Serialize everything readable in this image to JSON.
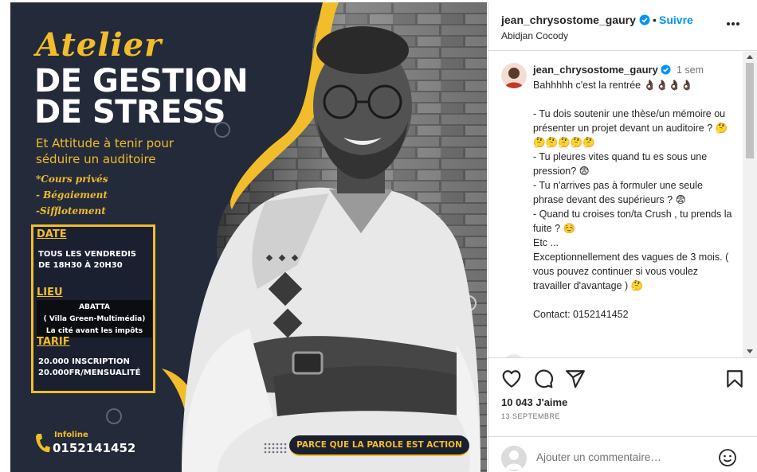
{
  "poster": {
    "atelier": "Atelier",
    "title_line_1": "DE GESTION",
    "title_line_2": "DE STRESS",
    "subtitle": "Et Attitude à tenir pour séduire un auditoire",
    "bullets": [
      "*Cours privés",
      "- Bégaiement",
      "-Sifflotement"
    ],
    "date_label": "DATE",
    "date_value_1": "TOUS LES VENDREDIS",
    "date_value_2": "DE 18H30 À 20H30",
    "lieu_label": "LIEU",
    "lieu_value_1": "ABATTA",
    "lieu_value_2": "( Villa Green-Multimédia)",
    "lieu_value_3": "La cité avant les impôts",
    "tarif_label": "TARIF",
    "tarif_value_1": "20.000 INSCRIPTION",
    "tarif_value_2": "20.000FR/MENSUALITÉ",
    "infoline_label": "Infoline",
    "infoline_number": "0152141452",
    "slogan": "PARCE QUE LA PAROLE EST ACTION",
    "colors": {
      "accent": "#f2bd2a",
      "navy": "#232a3a"
    }
  },
  "header": {
    "username": "jean_chrysostome_gaury",
    "dot": "•",
    "follow_label": "Suivre",
    "location": "Abidjan Cocody"
  },
  "caption": {
    "username": "jean_chrysostome_gaury",
    "time": "1 sem",
    "text": "Bahhhhh c'est la rentrée 👌🏿👌🏿👌🏿👌🏿\n\n- Tu dois soutenir une thèse/un mémoire ou présenter un projet devant un auditoire ? 🤔🤔🤔🤔🤔🤔\n- Tu pleures vites quand tu es sous une pression? 😨\n- Tu n'arrives pas à formuler une seule phrase devant des supérieurs ? 😨\n- Quand tu croises ton/ta Crush , tu prends la fuite ? ☺️\nEtc ...\nExceptionnellement des vagues de 3 mois. ( vous pouvez continuer si vous voulez travailler d'avantage ) 🤔\n\nContact: 0152141452"
  },
  "actions": {
    "likes": "10 043 J'aime",
    "date": "13 SEPTEMBRE",
    "comment_placeholder": "Ajouter un commentaire…"
  },
  "icons": {
    "verified": "verified-badge-icon",
    "more": "more-options-icon",
    "like": "heart-icon",
    "comment": "comment-bubble-icon",
    "share": "paper-plane-icon",
    "save": "bookmark-icon",
    "emoji": "emoji-icon",
    "phone": "phone-icon"
  },
  "colors": {
    "link_blue": "#0095f6",
    "verified_blue": "#0095f6",
    "border": "#dbdbdb"
  }
}
